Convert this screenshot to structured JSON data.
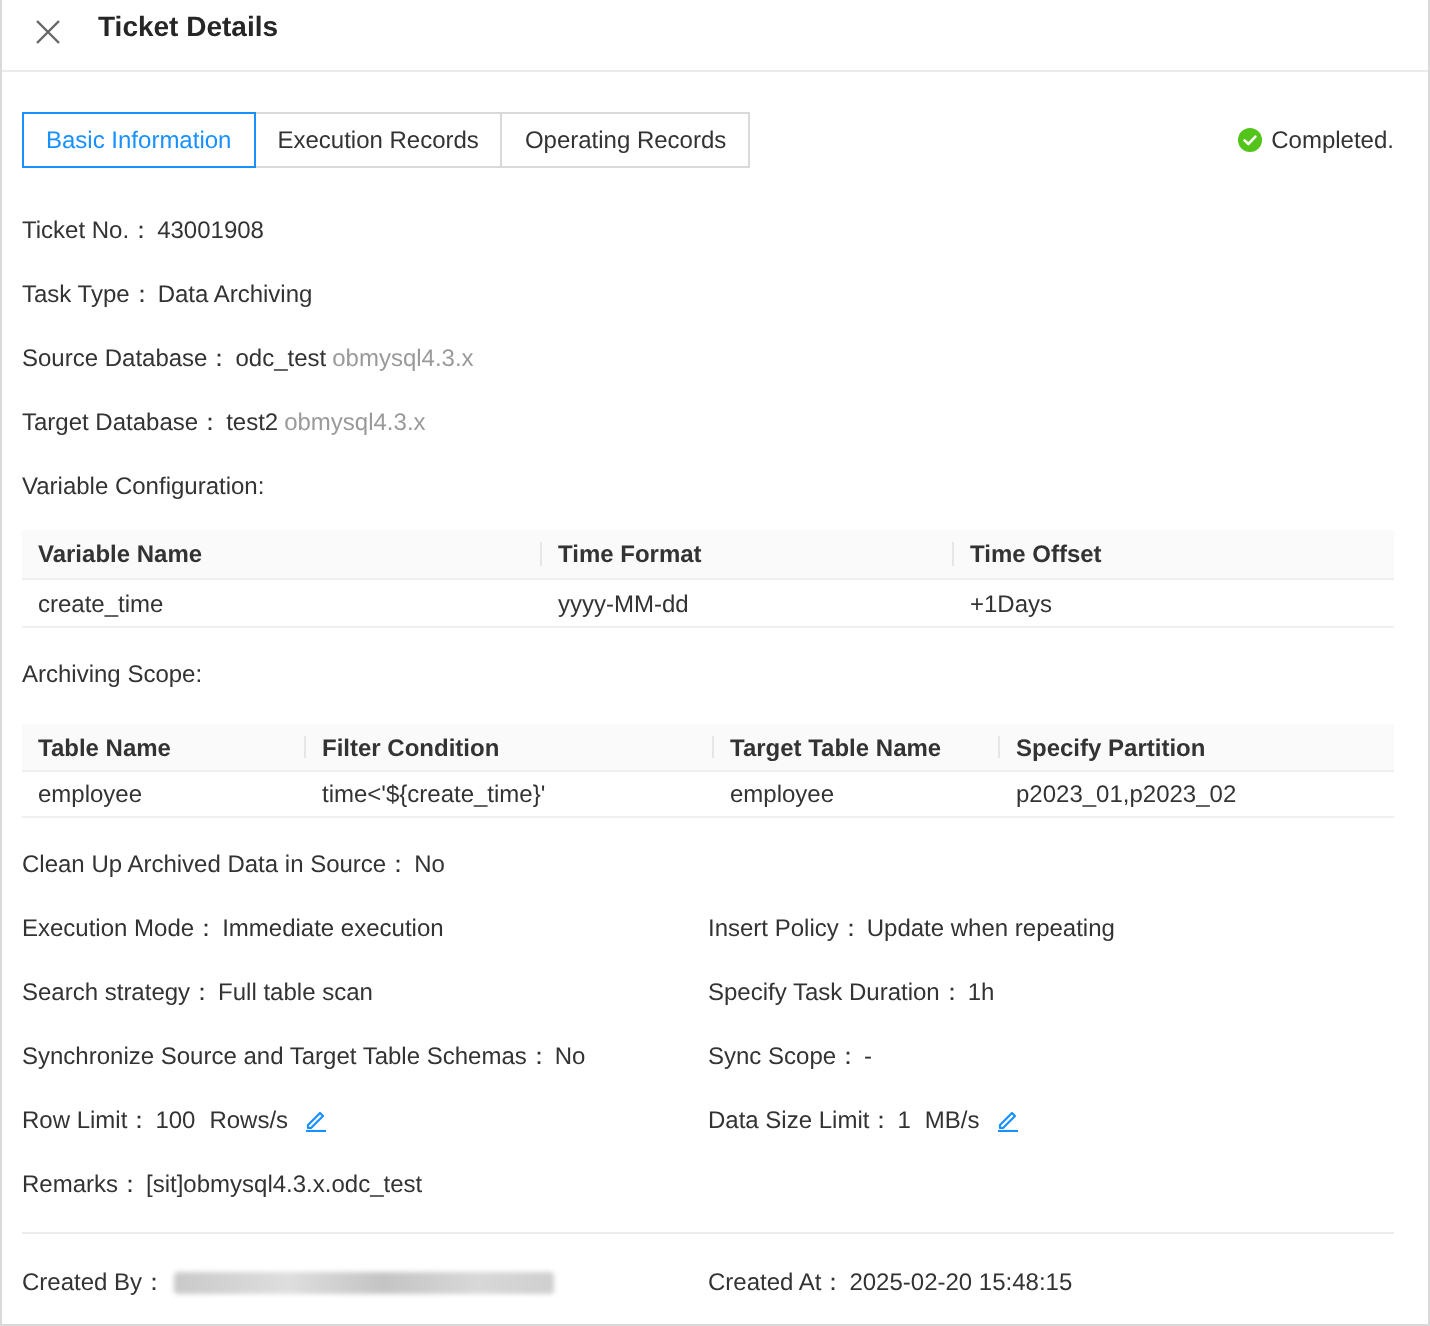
{
  "header": {
    "title": "Ticket Details"
  },
  "tabs": [
    {
      "label": "Basic Information",
      "selected": true
    },
    {
      "label": "Execution Records",
      "selected": false
    },
    {
      "label": "Operating Records",
      "selected": false
    }
  ],
  "status": {
    "kind": "success",
    "label": "Completed."
  },
  "fields": [
    {
      "label": "Ticket No.：",
      "value": "43001908"
    },
    {
      "label": "Task Type：",
      "value": "Data Archiving"
    },
    {
      "label": "Source Database：",
      "value": "odc_test",
      "note": "obmysql4.3.x"
    },
    {
      "label": "Target Database：",
      "value": "test2",
      "note": "obmysql4.3.x"
    }
  ],
  "variable_configuration": {
    "label": "Variable Configuration:",
    "columns": [
      "Variable Name",
      "Time Format",
      "Time Offset"
    ],
    "rows": [
      [
        "create_time",
        "yyyy-MM-dd",
        "+1Days"
      ]
    ]
  },
  "archiving_scope": {
    "label": "Archiving Scope:",
    "columns": [
      "Table Name",
      "Filter Condition",
      "Target Table Name",
      "Specify Partition"
    ],
    "rows": [
      [
        "employee",
        "time<'${create_time}'",
        "employee",
        "p2023_01,p2023_02"
      ]
    ]
  },
  "settings": [
    [
      {
        "label": "Clean Up Archived Data in Source：",
        "value": "No"
      }
    ],
    [
      {
        "label": "Execution Mode：",
        "value": "Immediate execution"
      },
      {
        "label": "Insert Policy：",
        "value": "Update when repeating"
      }
    ],
    [
      {
        "label": "Search strategy：",
        "value": "Full table scan"
      },
      {
        "label": "Specify Task Duration：",
        "value": "1h"
      }
    ],
    [
      {
        "label": "Synchronize Source and Target Table Schemas：",
        "value": "No"
      },
      {
        "label": "Sync Scope：",
        "value": "-"
      }
    ],
    [
      {
        "label": "Row Limit：",
        "value": "100",
        "unit": "Rows/s",
        "editable": true
      },
      {
        "label": "Data Size Limit：",
        "value": "1",
        "unit": "MB/s",
        "editable": true
      }
    ],
    [
      {
        "label": "Remarks：",
        "value": "[sit]obmysql4.3.x.odc_test"
      }
    ]
  ],
  "footer": [
    {
      "label": "Created By：",
      "redacted": true
    },
    {
      "label": "Created At：",
      "value": "2025-02-20 15:48:15"
    }
  ]
}
